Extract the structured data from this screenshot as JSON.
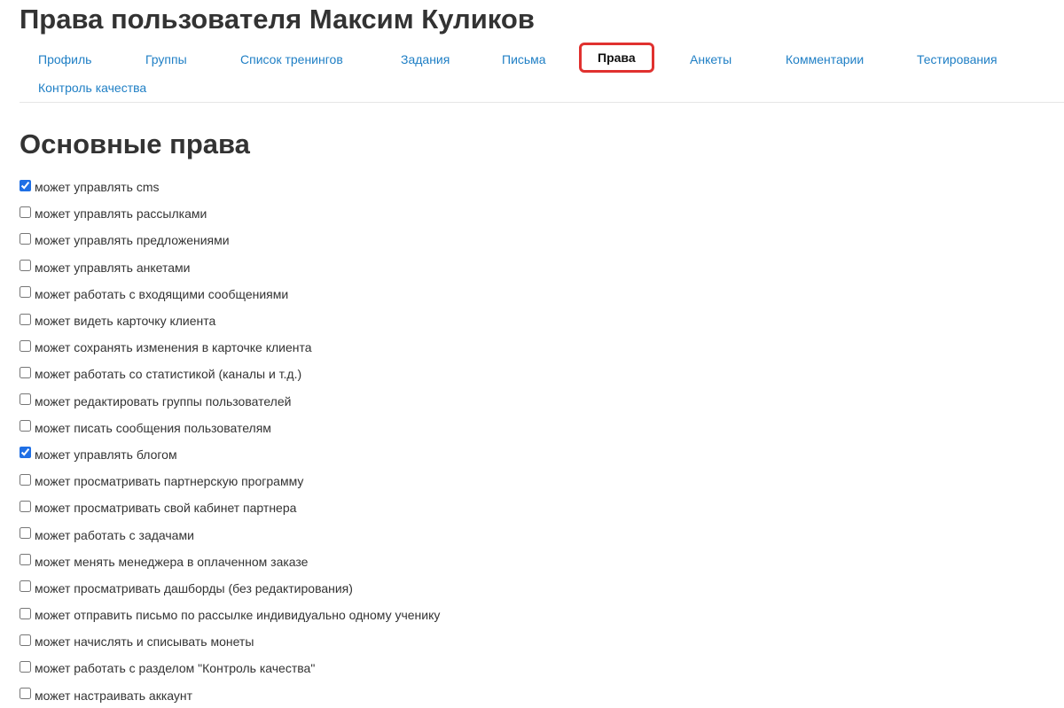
{
  "page_title": "Права пользователя Максим Куликов",
  "tabs": [
    {
      "label": "Профиль",
      "active": false
    },
    {
      "label": "Группы",
      "active": false
    },
    {
      "label": "Список тренингов",
      "active": false
    },
    {
      "label": "Задания",
      "active": false
    },
    {
      "label": "Письма",
      "active": false
    },
    {
      "label": "Права",
      "active": true
    },
    {
      "label": "Анкеты",
      "active": false
    },
    {
      "label": "Комментарии",
      "active": false
    },
    {
      "label": "Тестирования",
      "active": false
    },
    {
      "label": "Контроль качества",
      "active": false
    }
  ],
  "section_title": "Основные права",
  "permissions": [
    {
      "label": "может управлять cms",
      "checked": true
    },
    {
      "label": "может управлять рассылками",
      "checked": false
    },
    {
      "label": "может управлять предложениями",
      "checked": false
    },
    {
      "label": "может управлять анкетами",
      "checked": false
    },
    {
      "label": "может работать с входящими сообщениями",
      "checked": false
    },
    {
      "label": "может видеть карточку клиента",
      "checked": false
    },
    {
      "label": "может сохранять изменения в карточке клиента",
      "checked": false
    },
    {
      "label": "может работать со статистикой (каналы и т.д.)",
      "checked": false
    },
    {
      "label": "может редактировать группы пользователей",
      "checked": false
    },
    {
      "label": "может писать сообщения пользователям",
      "checked": false
    },
    {
      "label": "может управлять блогом",
      "checked": true
    },
    {
      "label": "может просматривать партнерскую программу",
      "checked": false
    },
    {
      "label": "может просматривать свой кабинет партнера",
      "checked": false
    },
    {
      "label": "может работать с задачами",
      "checked": false
    },
    {
      "label": "может менять менеджера в оплаченном заказе",
      "checked": false
    },
    {
      "label": "может просматривать дашборды (без редактирования)",
      "checked": false
    },
    {
      "label": "может отправить письмо по рассылке индивидуально одному ученику",
      "checked": false
    },
    {
      "label": "может начислять и списывать монеты",
      "checked": false
    },
    {
      "label": "может работать с разделом \"Контроль качества\"",
      "checked": false
    },
    {
      "label": "может настраивать аккаунт",
      "checked": false
    }
  ],
  "colors": {
    "link": "#1f7fc5",
    "active_tab_border": "#e0312f",
    "heading": "#333333"
  }
}
